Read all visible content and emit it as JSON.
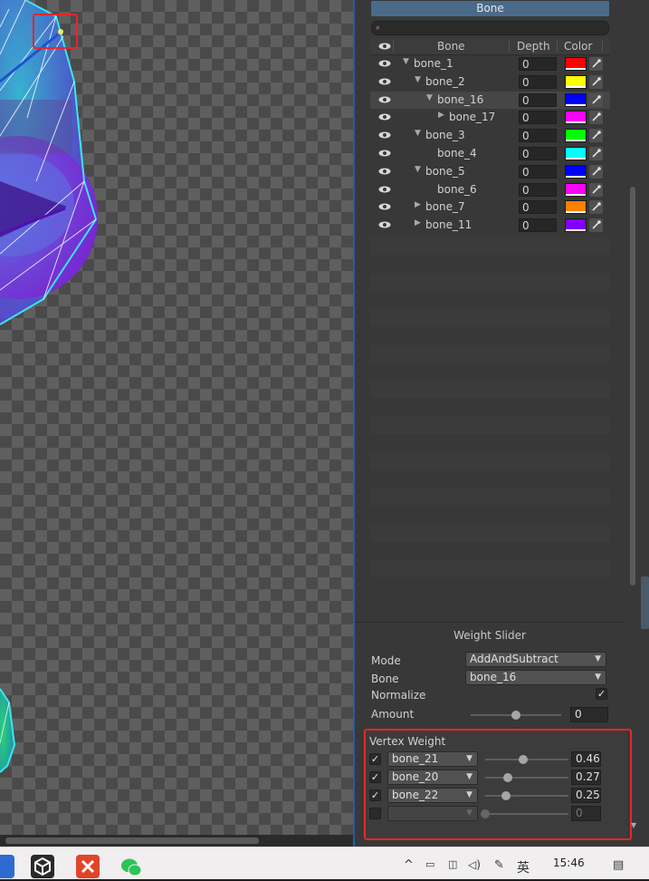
{
  "bone_panel": {
    "header": "Bone",
    "search_icon": "⌕",
    "columns": {
      "bone": "Bone",
      "depth": "Depth",
      "color": "Color"
    },
    "bones": [
      {
        "name": "bone_1",
        "depth": "0",
        "color": "#ff0000",
        "expanded": true
      },
      {
        "name": "bone_2",
        "depth": "0",
        "color": "#ffff00",
        "expanded": true
      },
      {
        "name": "bone_16",
        "depth": "0",
        "color": "#0000ff",
        "expanded": true,
        "selected": true
      },
      {
        "name": "bone_17",
        "depth": "0",
        "color": "#ff00ff",
        "expanded": false
      },
      {
        "name": "bone_3",
        "depth": "0",
        "color": "#00ff00",
        "expanded": true
      },
      {
        "name": "bone_4",
        "depth": "0",
        "color": "#00ffff"
      },
      {
        "name": "bone_5",
        "depth": "0",
        "color": "#0000ff",
        "expanded": true
      },
      {
        "name": "bone_6",
        "depth": "0",
        "color": "#ff00ff"
      },
      {
        "name": "bone_7",
        "depth": "0",
        "color": "#ff8000",
        "expanded": false
      },
      {
        "name": "bone_11",
        "depth": "0",
        "color": "#8000ff",
        "expanded": false
      }
    ]
  },
  "weight_slider": {
    "title": "Weight Slider",
    "mode_label": "Mode",
    "mode_value": "AddAndSubtract",
    "bone_label": "Bone",
    "bone_value": "bone_16",
    "normalize_label": "Normalize",
    "normalize_checked": true,
    "amount_label": "Amount",
    "amount_value": "0",
    "amount_fraction": 0.5
  },
  "vertex_weight": {
    "header": "Vertex Weight",
    "rows": [
      {
        "checked": true,
        "bone": "bone_21",
        "value": "0.46",
        "fraction": 0.46
      },
      {
        "checked": true,
        "bone": "bone_20",
        "value": "0.27",
        "fraction": 0.27
      },
      {
        "checked": true,
        "bone": "bone_22",
        "value": "0.25",
        "fraction": 0.25
      },
      {
        "checked": false,
        "bone": "",
        "value": "0",
        "fraction": 0
      }
    ]
  },
  "taskbar": {
    "ime": "英",
    "time": "15:46",
    "tray_icons": [
      "chevron-up-icon",
      "battery-icon",
      "network-icon",
      "volume-icon",
      "pen-icon"
    ],
    "apps": [
      "unity-app-icon",
      "xmind-app-icon",
      "wechat-app-icon"
    ]
  },
  "colors": {
    "accent": "#4a6a8a",
    "highlight_red": "#e8262b",
    "mesh_cyan": "#3ae6ee"
  }
}
